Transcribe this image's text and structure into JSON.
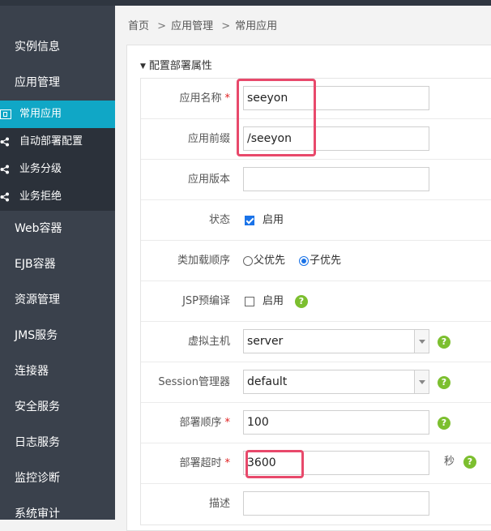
{
  "colors": {
    "sidebar_bg": "#3a414c",
    "active_bg": "#10a7c6",
    "accent": "#1a73e8",
    "help": "#7cbf2f",
    "highlight": "#e8496b",
    "required": "#e02020"
  },
  "sidebar": {
    "items": [
      {
        "label": "实例信息"
      },
      {
        "label": "应用管理"
      },
      {
        "label": "常用应用"
      },
      {
        "label": "自动部署配置"
      },
      {
        "label": "业务分级"
      },
      {
        "label": "业务拒绝"
      },
      {
        "label": "Web容器"
      },
      {
        "label": "EJB容器"
      },
      {
        "label": "资源管理"
      },
      {
        "label": "JMS服务"
      },
      {
        "label": "连接器"
      },
      {
        "label": "安全服务"
      },
      {
        "label": "日志服务"
      },
      {
        "label": "监控诊断"
      },
      {
        "label": "系统审计"
      }
    ]
  },
  "breadcrumb": {
    "home": "首页",
    "level1": "应用管理",
    "level2": "常用应用",
    "separator": ">"
  },
  "panel": {
    "title": "配置部署属性"
  },
  "form": {
    "required_mark": "*",
    "app_name": {
      "label": "应用名称",
      "value": "seeyon"
    },
    "app_prefix": {
      "label": "应用前缀",
      "value": "/seeyon"
    },
    "app_version": {
      "label": "应用版本",
      "value": ""
    },
    "status": {
      "label": "状态",
      "option": "启用",
      "checked": true
    },
    "classload": {
      "label": "类加载顺序",
      "option_parent": "父优先",
      "option_child": "子优先",
      "selected": "子优先"
    },
    "jsp": {
      "label": "JSP预编译",
      "option": "启用",
      "checked": false
    },
    "vhost": {
      "label": "虚拟主机",
      "value": "server"
    },
    "session": {
      "label": "Session管理器",
      "value": "default"
    },
    "deploy_order": {
      "label": "部署顺序",
      "value": "100"
    },
    "deploy_timeout": {
      "label": "部署超时",
      "value": "3600",
      "unit": "秒"
    },
    "description": {
      "label": "描述",
      "value": ""
    }
  },
  "help_glyph": "?"
}
